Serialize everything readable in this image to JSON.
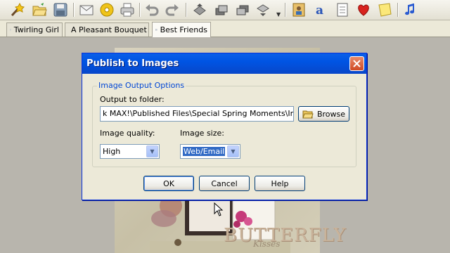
{
  "toolbar": {
    "icons": [
      "wand-icon",
      "open-folder-icon",
      "save-icon",
      "email-icon",
      "cd-icon",
      "print-icon",
      "undo-icon",
      "redo-icon",
      "bring-to-front-icon",
      "bring-forward-icon",
      "send-backward-icon",
      "send-to-back-icon",
      "contact-card-icon",
      "text-icon",
      "journal-icon",
      "heart-icon",
      "sticky-note-icon",
      "music-icon"
    ]
  },
  "tabs": [
    {
      "label": "Twirling Girl",
      "active": false
    },
    {
      "label": "A Pleasant Bouquet",
      "active": false
    },
    {
      "label": "Best Friends",
      "active": true
    }
  ],
  "document": {
    "decorative_text": "BUTTERFLY",
    "decorative_script": "Kisses"
  },
  "dialog": {
    "title": "Publish to Images",
    "group_label": "Image Output Options",
    "folder_label": "Output to folder:",
    "folder_value": "k MAX!\\Published Files\\Special Spring Moments\\Images",
    "browse_label": "Browse",
    "quality_label": "Image quality:",
    "quality_value": "High",
    "size_label": "Image size:",
    "size_value": "Web/Email",
    "ok_label": "OK",
    "cancel_label": "Cancel",
    "help_label": "Help"
  },
  "colors": {
    "titlebar": "#0054e3",
    "dialog_bg": "#ece9d8",
    "group_label": "#0046d5",
    "selection": "#316ac5"
  }
}
